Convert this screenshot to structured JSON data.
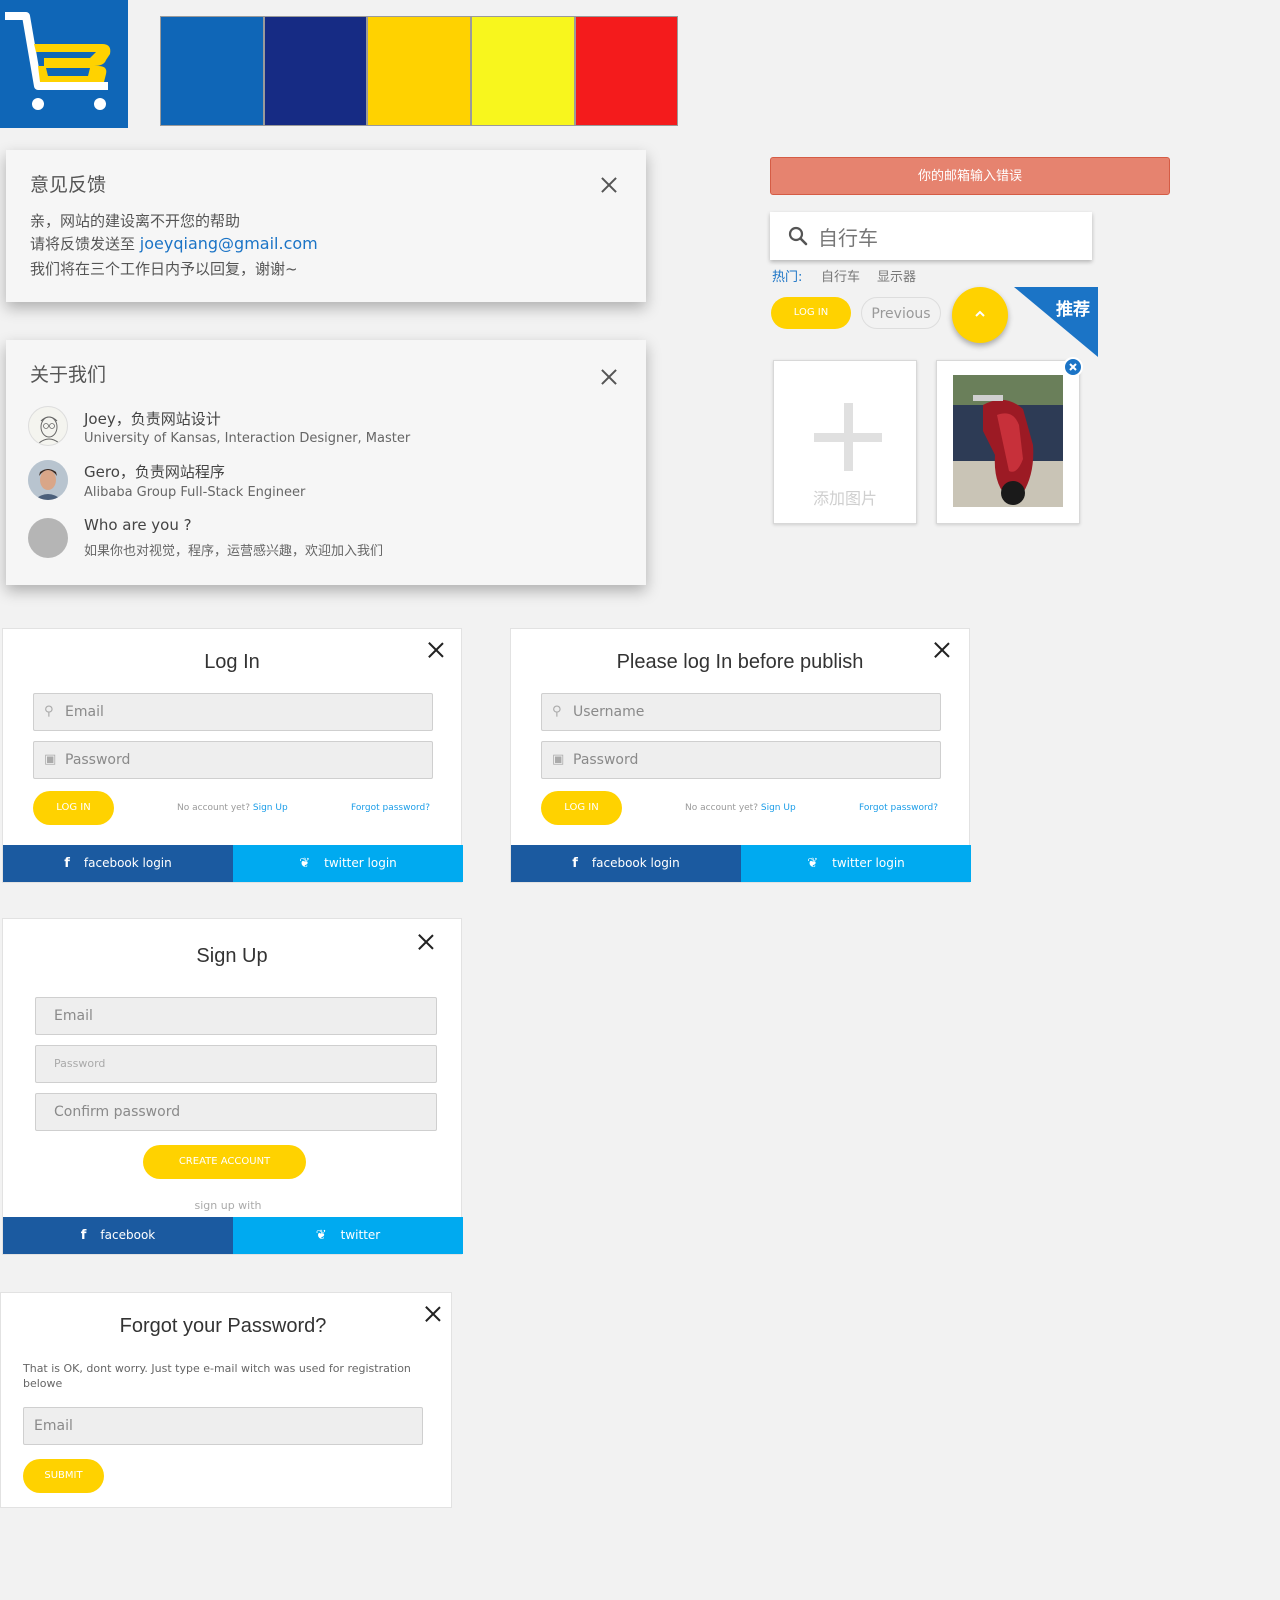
{
  "palette": {
    "swatches": [
      "#0f66b7",
      "#162b84",
      "#ffd200",
      "#f8f61d",
      "#f41b1c"
    ]
  },
  "feedback": {
    "title": "意见反馈",
    "line1": "亲，网站的建设离不开您的帮助",
    "line2": "请将反馈发送至",
    "email": "joeyqiang@gmail.com",
    "line3": "我们将在三个工作日内予以回复，谢谢~"
  },
  "about": {
    "title": "关于我们",
    "members": [
      {
        "name": "Joey，负责网站设计",
        "desc": "University of Kansas, Interaction Designer, Master"
      },
      {
        "name": "Gero，负责网站程序",
        "desc": "Alibaba Group Full-Stack Engineer"
      },
      {
        "name": "Who are you ?",
        "desc": "如果你也对视觉，程序，运营感兴趣，欢迎加入我们"
      }
    ]
  },
  "widgets": {
    "error_message": "你的邮箱输入错误",
    "search_placeholder": "自行车",
    "hot_label": "热门:",
    "hot_tags": [
      "自行车",
      "显示器"
    ],
    "login_button": "LOG IN",
    "previous_button": "Previous",
    "ribbon": "推荐",
    "add_image": "添加图片"
  },
  "login": {
    "title": "Log In",
    "email_placeholder": "Email",
    "password_placeholder": "Password",
    "button": "LOG IN",
    "no_account": "No account yet?",
    "sign_up": "Sign Up",
    "forgot": "Forgot password?",
    "facebook": "facebook login",
    "twitter": "twitter login"
  },
  "publish_login": {
    "title": "Please log In before publish",
    "username_placeholder": "Username",
    "password_placeholder": "Password",
    "button": "LOG IN",
    "no_account": "No account yet?",
    "sign_up": "Sign Up",
    "forgot": "Forgot password?",
    "facebook": "facebook login",
    "twitter": "twitter login"
  },
  "signup": {
    "title": "Sign Up",
    "email_placeholder": "Email",
    "password_placeholder": "Password",
    "confirm_placeholder": "Confirm password",
    "button": "CREATE ACCOUNT",
    "sign_up_with": "sign up with",
    "facebook": "facebook",
    "twitter": "twitter"
  },
  "forgot": {
    "title": "Forgot your Password?",
    "description": "That is OK, dont worry. Just type e-mail witch was used for registration belowe",
    "email_placeholder": "Email",
    "button": "SUBMIT"
  }
}
